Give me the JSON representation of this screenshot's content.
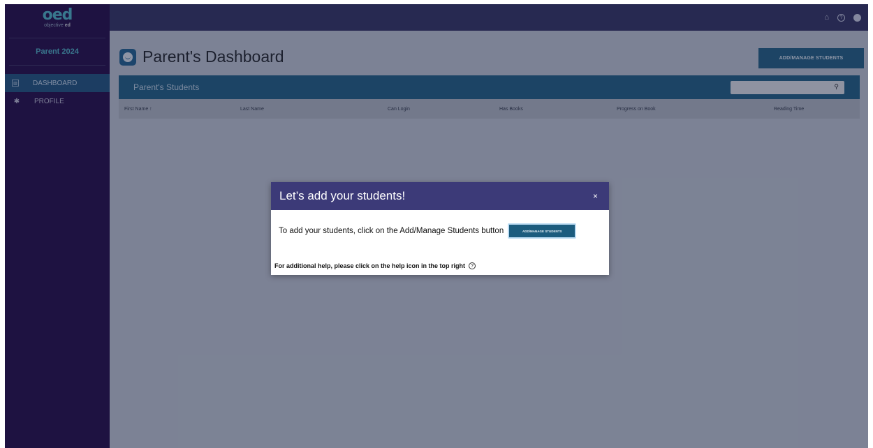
{
  "sidebar": {
    "logo_mark": "oed",
    "logo_sub_prefix": "objective",
    "logo_sub_bold": "ed",
    "account_label": "Parent 2024",
    "items": [
      {
        "label": "DASHBOARD",
        "icon": "dashboard-icon",
        "active": true
      },
      {
        "label": "PROFILE",
        "icon": "gear-icon",
        "active": false
      }
    ]
  },
  "topbar": {
    "icons": [
      "home-icon",
      "help-icon",
      "account-icon"
    ]
  },
  "main": {
    "title": "Parent's Dashboard",
    "add_button_label": "ADD/MANAGE STUDENTS",
    "panel": {
      "title": "Parent's Students",
      "search": {
        "value": "",
        "placeholder": ""
      },
      "columns": [
        "First Name ↑",
        "Last Name",
        "Can Login",
        "Has Books",
        "Progress on Book",
        "Reading Time"
      ]
    }
  },
  "modal": {
    "title": "Let’s add your students!",
    "close_label": "×",
    "body_text": "To add your students, click on the Add/Manage Students button",
    "inline_button_label": "ADD/MANAGE STUDENTS",
    "help_text": "For additional help, please click on the help icon in the top right"
  }
}
